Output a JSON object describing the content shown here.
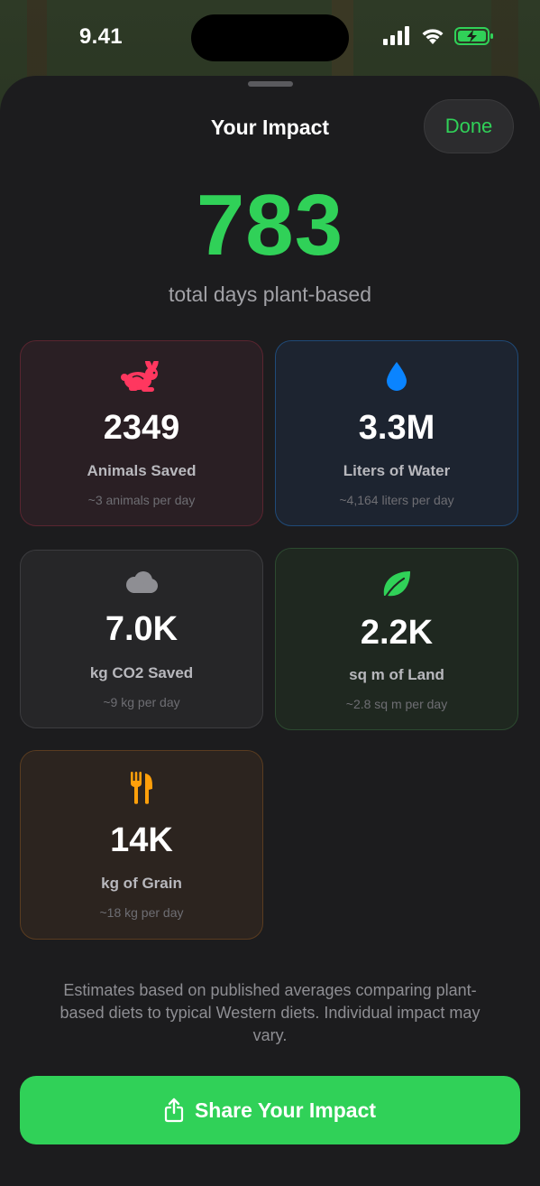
{
  "status_bar": {
    "time": "9.41",
    "icons": [
      "cellular-signal-icon",
      "wifi-icon",
      "battery-charging-icon"
    ]
  },
  "sheet": {
    "title": "Your Impact",
    "done_label": "Done"
  },
  "hero": {
    "value": "783",
    "caption": "total days plant-based",
    "color": "#30d158"
  },
  "stats": [
    {
      "icon": "rabbit-icon",
      "value": "2349",
      "label": "Animals Saved",
      "sub": "~3 animals per day",
      "accent": "#ff375f"
    },
    {
      "icon": "water-drop-icon",
      "value": "3.3M",
      "label": "Liters of Water",
      "sub": "~4,164 liters per day",
      "accent": "#0a84ff"
    },
    {
      "icon": "cloud-icon",
      "value": "7.0K",
      "label": "kg CO2 Saved",
      "sub": "~9 kg per day",
      "accent": "#8e8e93"
    },
    {
      "icon": "leaf-icon",
      "value": "2.2K",
      "label": "sq m of Land",
      "sub": "~2.8 sq m per day",
      "accent": "#30d158"
    },
    {
      "icon": "fork-knife-icon",
      "value": "14K",
      "label": "kg of Grain",
      "sub": "~18 kg per day",
      "accent": "#ff9f0a"
    }
  ],
  "disclaimer": "Estimates based on published averages comparing plant-based diets to typical Western diets. Individual impact may vary.",
  "share": {
    "label": "Share Your Impact",
    "icon": "share-icon",
    "color": "#30d158"
  }
}
